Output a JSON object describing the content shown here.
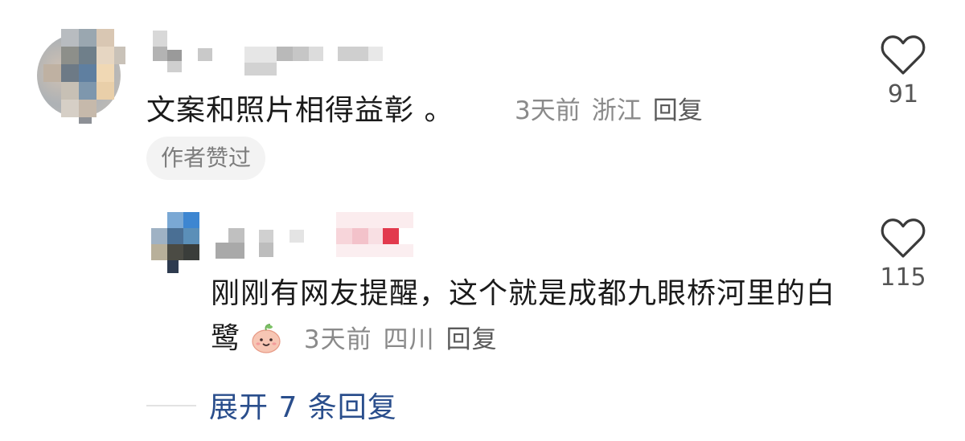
{
  "comments": [
    {
      "text": "文案和照片相得益彰 。",
      "time": "3天前",
      "location": "浙江",
      "reply_label": "回复",
      "badge": "作者赞过",
      "likes": "91"
    },
    {
      "text": "刚刚有网友提醒，这个就是成都九眼桥河里的白鹭",
      "emoji": "smiling-peach-icon",
      "time": "3天前",
      "location": "四川",
      "reply_label": "回复",
      "likes": "115"
    }
  ],
  "expand_replies": "展开 7 条回复",
  "icons": {
    "like": "heart-outline-icon"
  },
  "colors": {
    "link_blue": "#2a4e8c",
    "meta_gray": "#8a8a8a",
    "badge_bg": "#f3f3f3"
  }
}
